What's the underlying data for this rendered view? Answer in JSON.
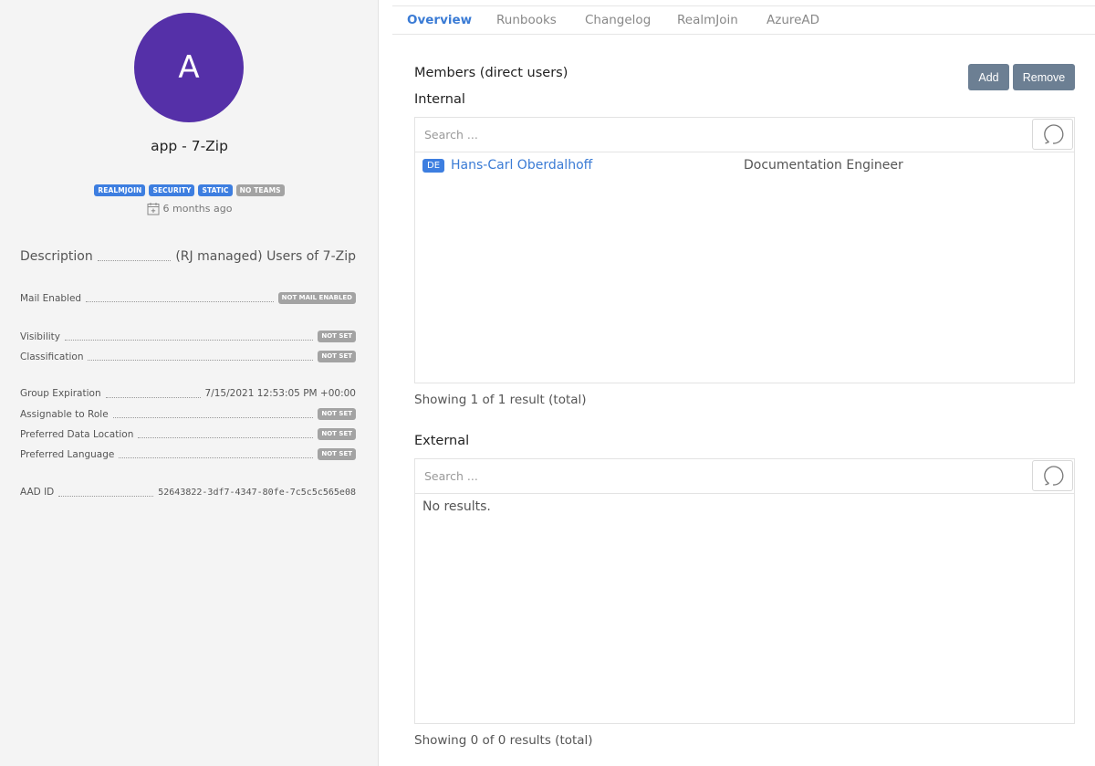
{
  "sidebar": {
    "avatar_letter": "A",
    "title": "app - 7-Zip",
    "tags": [
      {
        "label": "REALMJOIN",
        "color": "blue"
      },
      {
        "label": "SECURITY",
        "color": "blue"
      },
      {
        "label": "STATIC",
        "color": "blue"
      },
      {
        "label": "NO TEAMS",
        "color": "grey"
      }
    ],
    "created": "6 months ago",
    "description": {
      "label": "Description",
      "value": "(RJ managed) Users of 7-Zip"
    },
    "mail_enabled": {
      "label": "Mail Enabled",
      "value": "NOT MAIL ENABLED"
    },
    "visibility": {
      "label": "Visibility",
      "value": "NOT SET"
    },
    "classification": {
      "label": "Classification",
      "value": "NOT SET"
    },
    "group_expiration": {
      "label": "Group Expiration",
      "value": "7/15/2021 12:53:05 PM +00:00"
    },
    "assignable_to_role": {
      "label": "Assignable to Role",
      "value": "NOT SET"
    },
    "preferred_data_location": {
      "label": "Preferred Data Location",
      "value": "NOT SET"
    },
    "preferred_language": {
      "label": "Preferred Language",
      "value": "NOT SET"
    },
    "aad_id": {
      "label": "AAD ID",
      "value": "52643822-3df7-4347-80fe-7c5c5c565e08"
    }
  },
  "tabs": [
    "Overview",
    "Runbooks",
    "Changelog",
    "RealmJoin",
    "AzureAD"
  ],
  "active_tab": "Overview",
  "members": {
    "title": "Members (direct users)",
    "add_label": "Add",
    "remove_label": "Remove",
    "internal": {
      "title": "Internal",
      "search_placeholder": "Search ...",
      "rows": [
        {
          "lang": "DE",
          "name": "Hans-Carl Oberdalhoff",
          "role": "Documentation Engineer"
        }
      ],
      "footer": "Showing 1 of 1 result (total)"
    },
    "external": {
      "title": "External",
      "search_placeholder": "Search ...",
      "empty_text": "No results.",
      "footer": "Showing 0 of 0 results (total)"
    }
  },
  "colors": {
    "accent": "#3a7bd5",
    "avatar": "#5530a8",
    "tag_blue": "#3d7ee0",
    "tag_grey": "#a3a3a3",
    "button": "#6c7f93"
  }
}
